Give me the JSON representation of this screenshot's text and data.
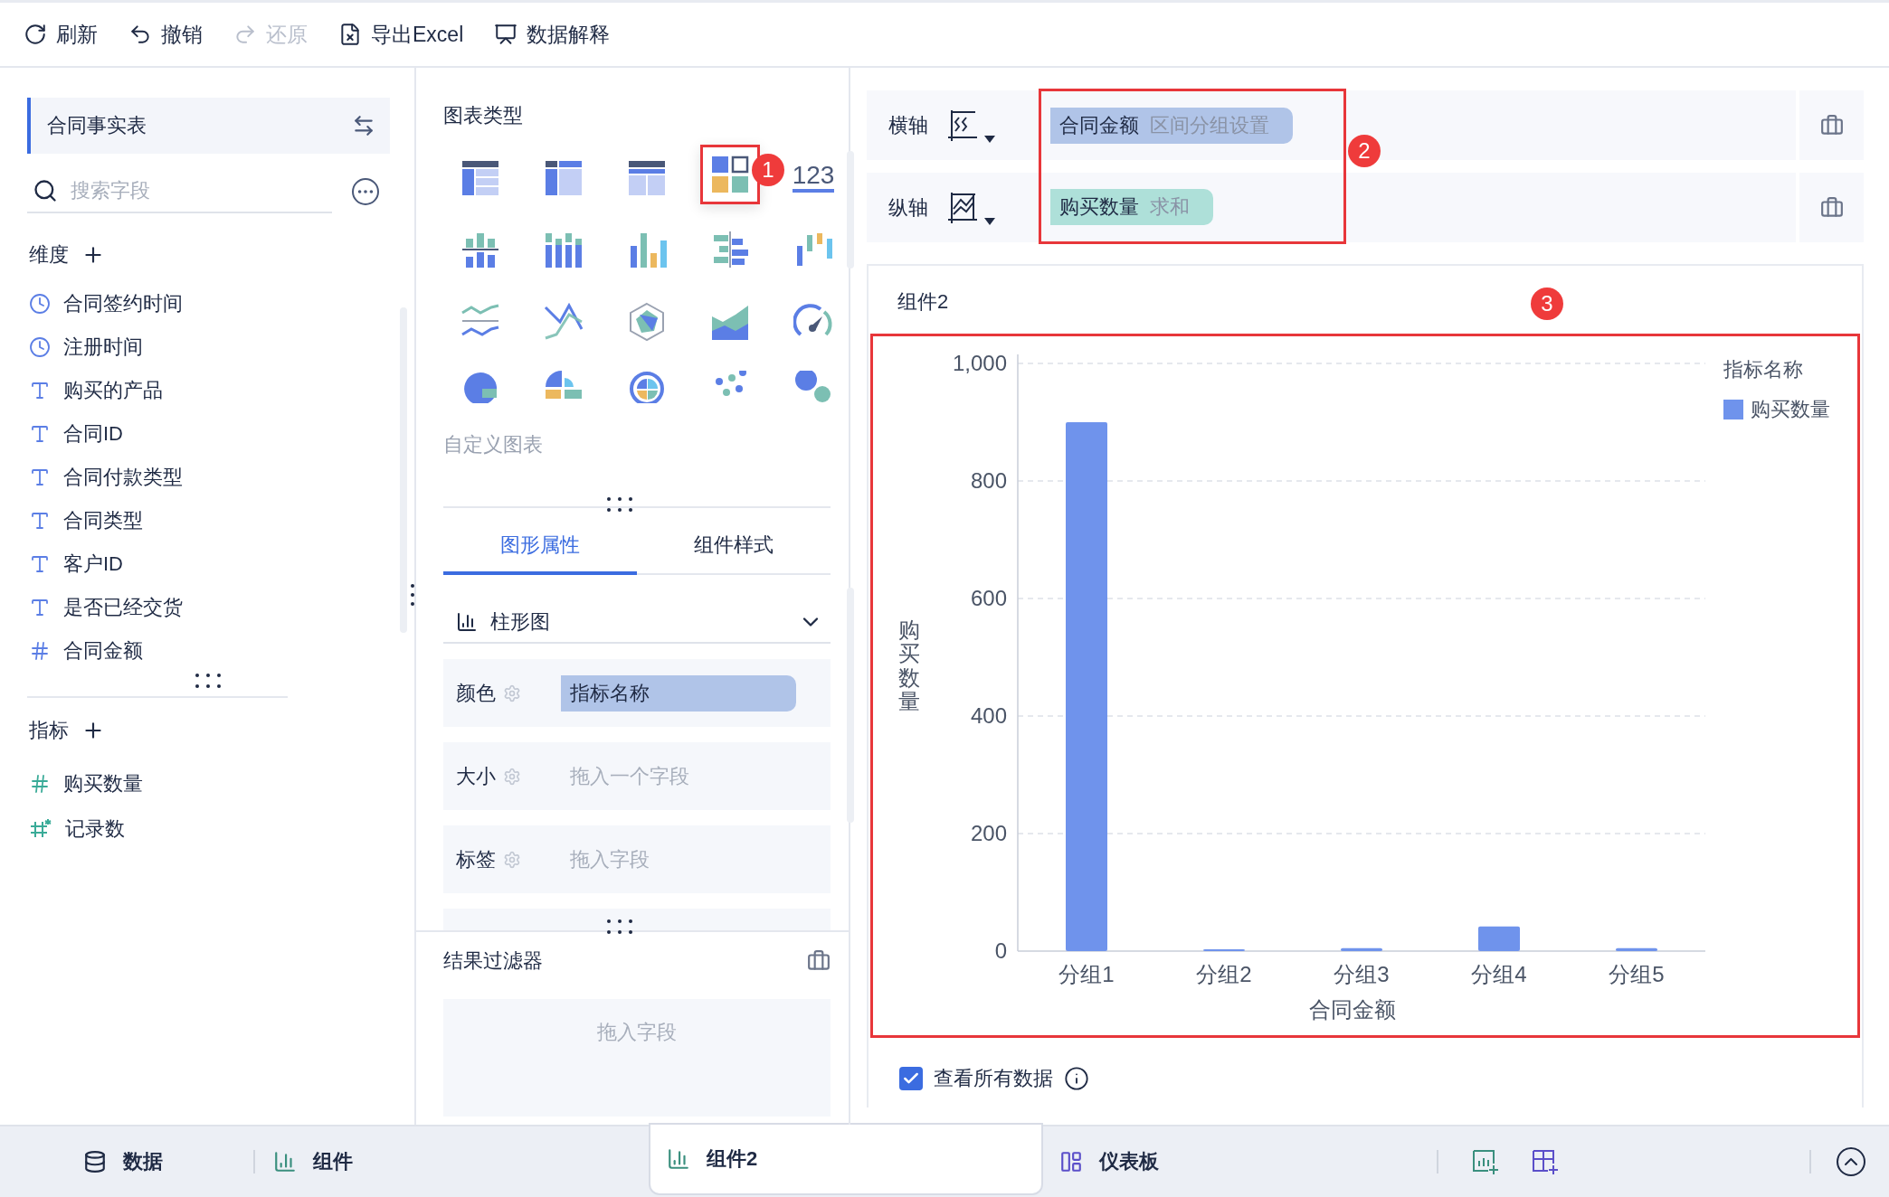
{
  "toolbar": [
    {
      "kind": "refresh",
      "label": "刷新",
      "disabled": false
    },
    {
      "kind": "undo",
      "label": "撤销",
      "disabled": false
    },
    {
      "kind": "redo",
      "label": "还原",
      "disabled": true
    },
    {
      "kind": "export",
      "label": "导出Excel",
      "disabled": false
    },
    {
      "kind": "explain",
      "label": "数据解释",
      "disabled": false
    }
  ],
  "data_panel": {
    "table_name": "合同事实表",
    "search": {
      "placeholder": "搜索字段"
    },
    "dimensions": {
      "title": "维度",
      "fields": [
        {
          "name": "合同签约时间",
          "kind": "date"
        },
        {
          "name": "注册时间",
          "kind": "date"
        },
        {
          "name": "购买的产品",
          "kind": "text"
        },
        {
          "name": "合同ID",
          "kind": "text"
        },
        {
          "name": "合同付款类型",
          "kind": "text"
        },
        {
          "name": "合同类型",
          "kind": "text"
        },
        {
          "name": "客户ID",
          "kind": "text"
        },
        {
          "name": "是否已经交货",
          "kind": "text"
        },
        {
          "name": "合同金额",
          "kind": "number"
        }
      ]
    },
    "measures": {
      "title": "指标",
      "fields": [
        {
          "name": "购买数量",
          "kind": "number"
        },
        {
          "name": "记录数",
          "kind": "count"
        }
      ]
    }
  },
  "chart_types": {
    "title": "图表类型",
    "badge": "1",
    "items": [
      {
        "kind": "cross-table",
        "selected": false
      },
      {
        "kind": "group-table",
        "selected": false
      },
      {
        "kind": "detail-table",
        "selected": false
      },
      {
        "kind": "cards",
        "selected": true
      },
      {
        "kind": "kpi",
        "text": "123",
        "selected": false
      },
      {
        "kind": "stacked-column",
        "selected": false
      },
      {
        "kind": "multi-column",
        "selected": false
      },
      {
        "kind": "column",
        "selected": false
      },
      {
        "kind": "mirror-bar",
        "selected": false
      },
      {
        "kind": "range-column",
        "selected": false
      },
      {
        "kind": "wave-line",
        "selected": false
      },
      {
        "kind": "cross-line",
        "selected": false
      },
      {
        "kind": "radar",
        "selected": false
      },
      {
        "kind": "area",
        "selected": false
      },
      {
        "kind": "gauge",
        "selected": false
      },
      {
        "kind": "pie",
        "selected": false
      },
      {
        "kind": "rose",
        "selected": false
      },
      {
        "kind": "ring",
        "selected": false
      },
      {
        "kind": "scatter",
        "selected": false
      },
      {
        "kind": "bubble",
        "selected": false
      }
    ],
    "custom": "自定义图表"
  },
  "property_tabs": [
    {
      "label": "图形属性",
      "selected": true
    },
    {
      "label": "组件样式",
      "selected": false
    }
  ],
  "chart_kind": "柱形图",
  "properties": [
    {
      "label": "颜色",
      "kind": "chip",
      "value": "指标名称"
    },
    {
      "label": "大小",
      "kind": "drop",
      "placeholder": "拖入一个字段"
    },
    {
      "label": "标签",
      "kind": "drop",
      "placeholder": "拖入字段"
    }
  ],
  "result_filter": {
    "title": "结果过滤器",
    "placeholder": "拖入字段"
  },
  "axes": {
    "badge": "2",
    "rows": [
      {
        "label": "横轴",
        "field": "合同金额",
        "setting": "区间分组设置",
        "color": "#b0c4e8"
      },
      {
        "label": "纵轴",
        "field": "购买数量",
        "setting": "求和",
        "color": "#aee0d9"
      }
    ]
  },
  "component": {
    "title": "组件2",
    "badge": "3",
    "legend": {
      "title": "指标名称"
    },
    "chart_data": {
      "type": "bar",
      "xlabel": "合同金额",
      "ylabel": "购买数量",
      "categories": [
        "分组1",
        "分组2",
        "分组3",
        "分组4",
        "分组5"
      ],
      "series": [
        {
          "name": "购买数量",
          "color": "#6f93ec",
          "values": [
            900,
            2,
            5,
            42,
            5
          ]
        }
      ],
      "ylim": [
        0,
        1000
      ],
      "grid": true,
      "yticks": [
        0,
        200,
        400,
        600,
        800,
        {
          "value": 1000,
          "label": "1,000"
        }
      ]
    },
    "view_all": {
      "label": "查看所有数据",
      "checked": true
    }
  },
  "bottom_tabs": [
    {
      "kind": "data",
      "label": "数据",
      "selected": false
    },
    {
      "kind": "chart",
      "label": "组件",
      "selected": false
    },
    {
      "kind": "chart",
      "label": "组件2",
      "selected": true
    },
    {
      "kind": "dashboard",
      "label": "仪表板",
      "selected": false
    }
  ]
}
